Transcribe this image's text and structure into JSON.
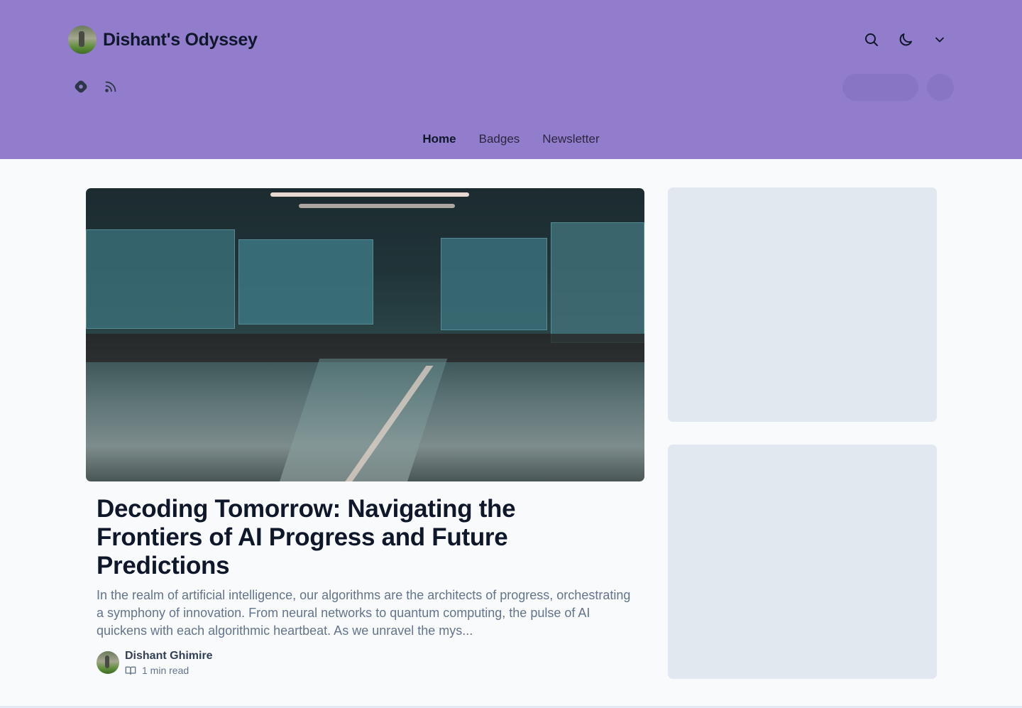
{
  "header": {
    "site_title": "Dishant's Odyssey",
    "background_color": "#927dcd",
    "top_icons": [
      "search-icon",
      "moon-icon",
      "chevron-down-icon"
    ],
    "social_icons": [
      "hashnode-icon",
      "rss-icon"
    ]
  },
  "nav": {
    "items": [
      {
        "label": "Home",
        "active": true
      },
      {
        "label": "Badges",
        "active": false
      },
      {
        "label": "Newsletter",
        "active": false
      }
    ]
  },
  "featured_post": {
    "title": "Decoding Tomorrow: Navigating the Frontiers of AI Progress and Future Predictions",
    "excerpt": "In the realm of artificial intelligence, our algorithms are the architects of progress, orchestrating a symphony of innovation. From neural networks to quantum computing, the pulse of AI quickens with each algorithmic heartbeat. As we unravel the mys...",
    "author_name": "Dishant Ghimire",
    "read_time": "1 min read"
  }
}
